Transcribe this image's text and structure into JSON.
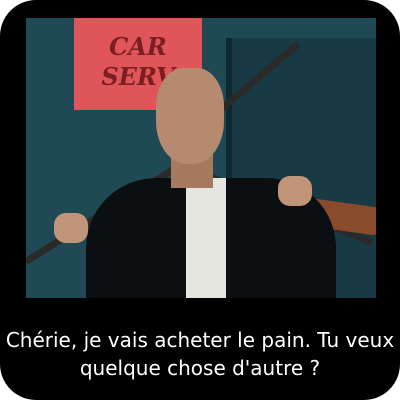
{
  "meme": {
    "caption": "Chérie, je vais acheter le pain. Tu veux quelque chose d'autre ?",
    "photo_sign_text": "CAR SERV",
    "colors": {
      "background": "#000000",
      "caption_text": "#ffffff",
      "sign": "#e0555a"
    }
  }
}
